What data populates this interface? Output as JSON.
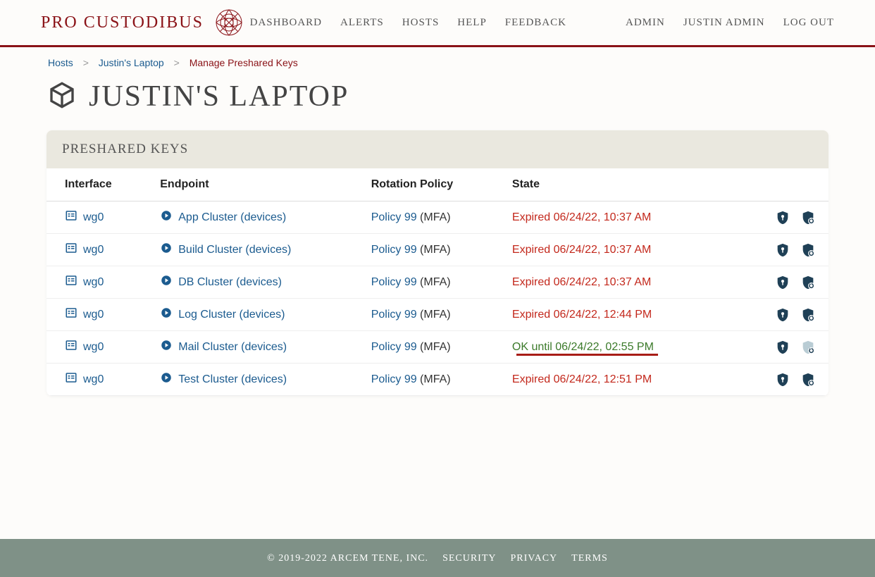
{
  "brand": {
    "name": "PRO CUSTODIBUS"
  },
  "nav": {
    "primary": [
      "DASHBOARD",
      "ALERTS",
      "HOSTS",
      "HELP",
      "FEEDBACK"
    ],
    "secondary": [
      "ADMIN",
      "JUSTIN ADMIN",
      "LOG OUT"
    ]
  },
  "breadcrumb": {
    "items": [
      {
        "label": "Hosts",
        "type": "link"
      },
      {
        "label": "Justin's Laptop",
        "type": "link"
      },
      {
        "label": "Manage Preshared Keys",
        "type": "current"
      }
    ]
  },
  "page_title": "JUSTIN'S LAPTOP",
  "panel_title": "PRESHARED KEYS",
  "columns": [
    "Interface",
    "Endpoint",
    "Rotation Policy",
    "State"
  ],
  "rows": [
    {
      "interface": "wg0",
      "endpoint": "App Cluster (devices)",
      "policy": "Policy 99",
      "policy_suffix": " (MFA)",
      "state_label": "Expired 06/24/22, 10:37 AM",
      "state_kind": "expired",
      "action2_disabled": false
    },
    {
      "interface": "wg0",
      "endpoint": "Build Cluster (devices)",
      "policy": "Policy 99",
      "policy_suffix": " (MFA)",
      "state_label": "Expired 06/24/22, 10:37 AM",
      "state_kind": "expired",
      "action2_disabled": false
    },
    {
      "interface": "wg0",
      "endpoint": "DB Cluster (devices)",
      "policy": "Policy 99",
      "policy_suffix": " (MFA)",
      "state_label": "Expired 06/24/22, 10:37 AM",
      "state_kind": "expired",
      "action2_disabled": false
    },
    {
      "interface": "wg0",
      "endpoint": "Log Cluster (devices)",
      "policy": "Policy 99",
      "policy_suffix": " (MFA)",
      "state_label": "Expired 06/24/22, 12:44 PM",
      "state_kind": "expired",
      "action2_disabled": false
    },
    {
      "interface": "wg0",
      "endpoint": "Mail Cluster (devices)",
      "policy": "Policy 99",
      "policy_suffix": " (MFA)",
      "state_label": "OK until 06/24/22, 02:55 PM",
      "state_kind": "ok",
      "action2_disabled": true
    },
    {
      "interface": "wg0",
      "endpoint": "Test Cluster (devices)",
      "policy": "Policy 99",
      "policy_suffix": " (MFA)",
      "state_label": "Expired 06/24/22, 12:51 PM",
      "state_kind": "expired",
      "action2_disabled": false
    }
  ],
  "footer": {
    "copyright": "© 2019-2022 ARCEM TENE, INC.",
    "links": [
      "SECURITY",
      "PRIVACY",
      "TERMS"
    ]
  }
}
